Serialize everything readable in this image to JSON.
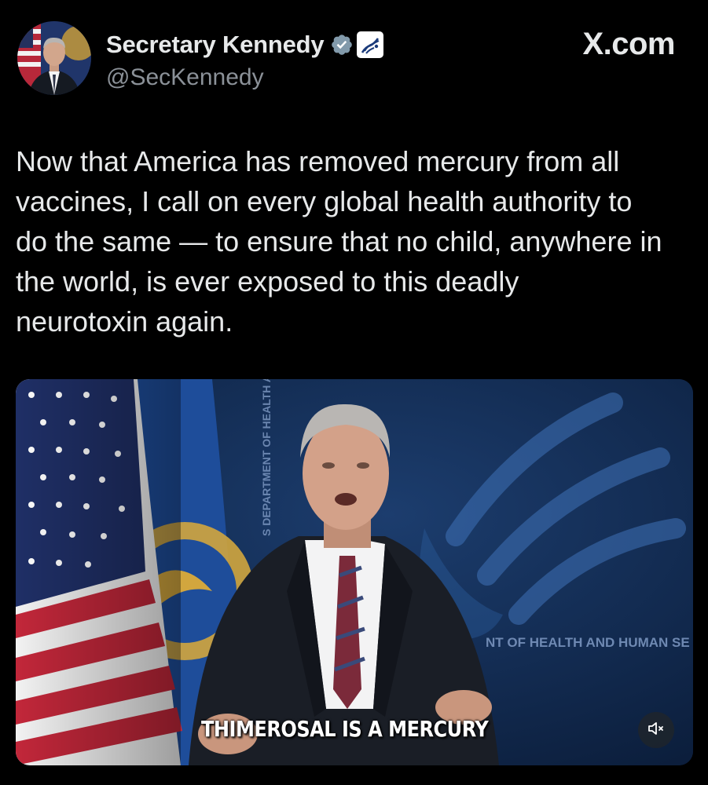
{
  "header": {
    "display_name": "Secretary Kennedy",
    "handle": "@SecKennedy",
    "brand": "X.com",
    "verified_icon": "verified-badge-icon",
    "affiliate_icon": "hhs-eagle-icon"
  },
  "tweet": {
    "text": "Now that America has removed mercury from all\nvaccines, I call on every global health authority to\ndo the same — to ensure that no child, anywhere in\nthe world, is ever exposed to this deadly\nneurotoxin again."
  },
  "video": {
    "caption": "THIMEROSAL IS A MERCURY",
    "backdrop_text_vertical": "S DEPARTMENT OF HEALTH ANI",
    "backdrop_text_horizontal": "NT OF HEALTH AND HUMAN SE",
    "mute_icon": "speaker-muted-icon"
  },
  "colors": {
    "background": "#000000",
    "text_primary": "#e7e9ea",
    "text_secondary": "#8b9198",
    "verified_blue": "#1d9bf0",
    "video_backdrop": "#11294f"
  }
}
